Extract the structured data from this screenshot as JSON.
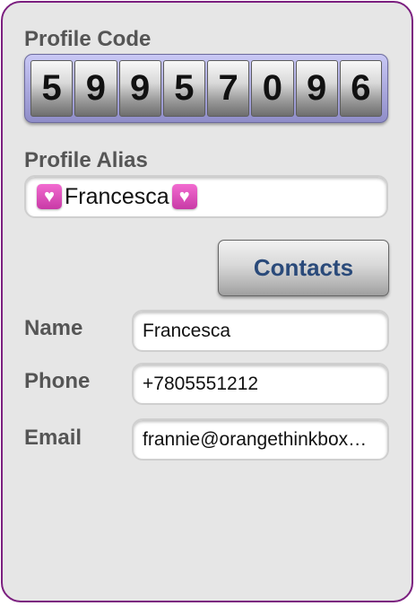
{
  "profile_code": {
    "label": "Profile Code",
    "digits": [
      "5",
      "9",
      "9",
      "5",
      "7",
      "0",
      "9",
      "6"
    ]
  },
  "profile_alias": {
    "label": "Profile Alias",
    "value": "Francesca",
    "icon": "heart-icon"
  },
  "contacts_button": {
    "label": "Contacts"
  },
  "fields": {
    "name": {
      "label": "Name",
      "value": "Francesca"
    },
    "phone": {
      "label": "Phone",
      "value": "+7805551212"
    },
    "email": {
      "label": "Email",
      "value": "frannie@orangethinkbox…"
    }
  },
  "colors": {
    "frame_border": "#7b1f7f",
    "background": "#e6e6e6",
    "button_text": "#2a4a7a",
    "heart": "#e05cc4"
  }
}
